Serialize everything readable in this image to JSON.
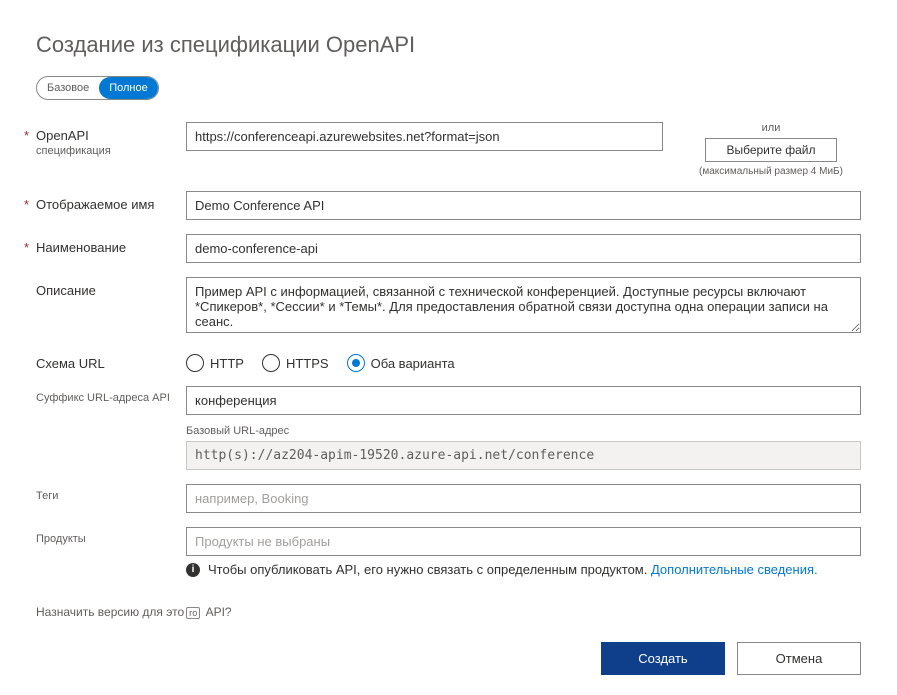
{
  "title": "Создание из спецификации OpenAPI",
  "toggle": {
    "basic": "Базовое",
    "full": "Полное"
  },
  "labels": {
    "openapi": "OpenAPI",
    "openapi_sub": "спецификация",
    "or": "или",
    "choose_file": "Выберите файл",
    "max_size": "(максимальный размер 4 МиБ)",
    "display_name": "Отображаемое имя",
    "name": "Наименование",
    "description": "Описание",
    "url_scheme": "Схема URL",
    "http": "HTTP",
    "https": "HTTPS",
    "both": "Оба варианта",
    "url_suffix": "Суффикс URL-адреса API",
    "base_url": "Базовый URL-адрес",
    "tags": "Теги",
    "products": "Продукты",
    "info": "Чтобы опубликовать API, его нужно связать с определенным продуктом. ",
    "info_link": "Дополнительные сведения.",
    "version_q1": "Назначить версию для это",
    "version_box": "го",
    "version_q2": " API?",
    "create": "Создать",
    "cancel": "Отмена"
  },
  "values": {
    "spec_url": "https://conferenceapi.azurewebsites.net?format=json",
    "display_name": "Demo Conference API",
    "name": "demo-conference-api",
    "description": "Пример API с информацией, связанной с технической конференцией. Доступные ресурсы включают *Спикеров*, *Сессии* и *Темы*. Для предоставления обратной связи доступна одна операции записи на сеанс.",
    "url_suffix": "конференция",
    "url_scheme_selected": "both",
    "base_url": "http(s)://az204-apim-19520.azure-api.net/conference",
    "tags": "",
    "products": ""
  },
  "placeholders": {
    "tags": "например, Booking",
    "products": "Продукты не выбраны"
  }
}
